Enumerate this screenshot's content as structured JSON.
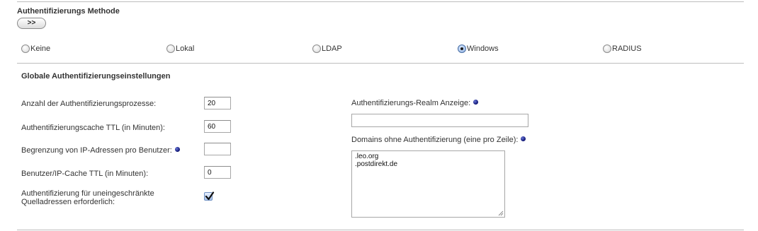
{
  "auth_method": {
    "title": "Authentifizierungs Methode",
    "toggle_label": ">>",
    "options": [
      {
        "label": "Keine",
        "checked": false
      },
      {
        "label": "Lokal",
        "checked": false
      },
      {
        "label": "LDAP",
        "checked": false
      },
      {
        "label": "Windows",
        "checked": true
      },
      {
        "label": "RADIUS",
        "checked": false
      }
    ]
  },
  "global": {
    "title": "Globale Authentifizierungseinstellungen",
    "processes_label": "Anzahl der Authentifizierungsprozesse:",
    "processes_value": "20",
    "cache_ttl_label": "Authentifizierungscache TTL (in Minuten):",
    "cache_ttl_value": "60",
    "ip_limit_label": "Begrenzung von IP-Adressen pro Benutzer:",
    "ip_limit_value": "",
    "user_ip_cache_label": "Benutzer/IP-Cache TTL (in Minuten):",
    "user_ip_cache_value": "0",
    "unrestricted_label_line1": "Authentifizierung für uneingeschränkte",
    "unrestricted_label_line2": "Quelladressen erforderlich:",
    "unrestricted_checked": true,
    "realm_label": "Authentifizierungs-Realm Anzeige:",
    "realm_value": "",
    "domains_label": "Domains ohne Authentifizierung (eine pro Zeile):",
    "domains": [
      ".leo.org",
      ".postdirekt.de"
    ]
  }
}
